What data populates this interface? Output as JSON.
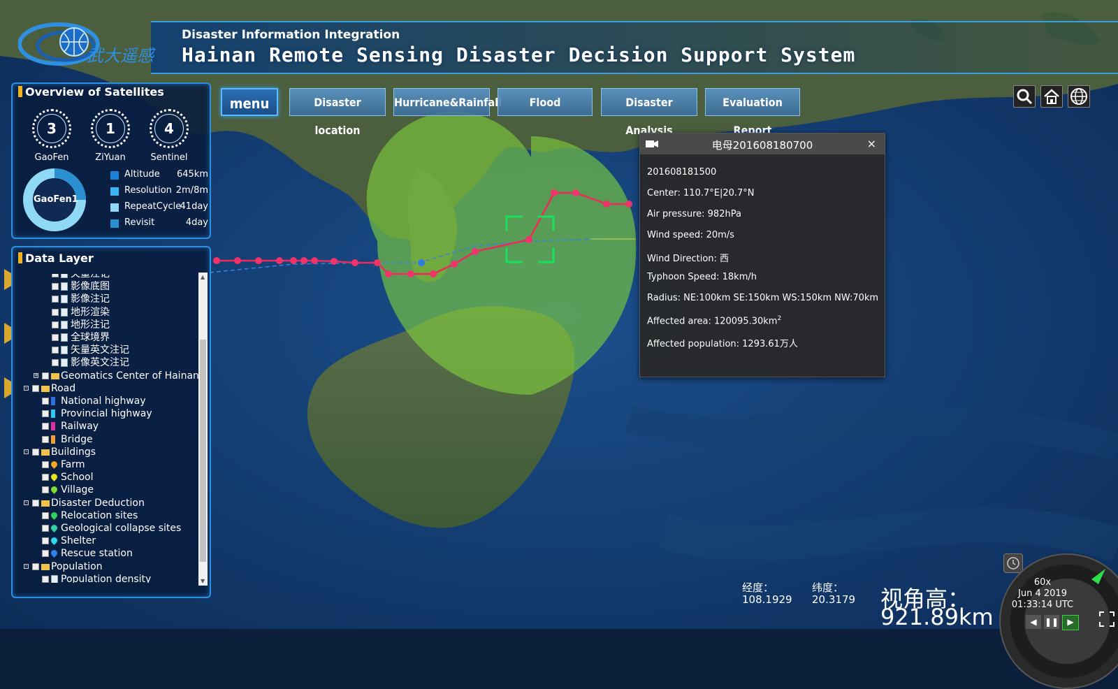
{
  "header": {
    "subtitle": "Disaster Information Integration",
    "title": "Hainan Remote Sensing Disaster Decision Support System",
    "logo_text": "武大遥感"
  },
  "nav": {
    "menu": "menu",
    "items": [
      "Disaster location",
      "Hurricane&Rainfall",
      "Flood",
      "Disaster Analysis",
      "Evaluation Report"
    ]
  },
  "toolbar_icons": [
    "search-icon",
    "home-icon",
    "globe-icon"
  ],
  "satellites": {
    "title": "Overview of Satellites",
    "counts": [
      {
        "value": "3",
        "name": "GaoFen"
      },
      {
        "value": "1",
        "name": "ZiYuan"
      },
      {
        "value": "4",
        "name": "Sentinel"
      }
    ],
    "donut_label": "GaoFen1",
    "info": [
      {
        "key": "Altitude",
        "value": "645km",
        "color": "#1e7fd8"
      },
      {
        "key": "Resolution",
        "value": "2m/8m",
        "color": "#3bb4f2"
      },
      {
        "key": "RepeatCycle",
        "value": "41day",
        "color": "#8fd8f6"
      },
      {
        "key": "Revisit",
        "value": "4day",
        "color": "#2a8fd0"
      }
    ]
  },
  "data_layer": {
    "title": "Data Layer",
    "items": [
      {
        "label": "矢量注记",
        "level": 2,
        "icon": "page"
      },
      {
        "label": "影像底图",
        "level": 2,
        "icon": "page"
      },
      {
        "label": "影像注记",
        "level": 2,
        "icon": "page"
      },
      {
        "label": "地形渲染",
        "level": 2,
        "icon": "page"
      },
      {
        "label": "地形注记",
        "level": 2,
        "icon": "page"
      },
      {
        "label": "全球境界",
        "level": 2,
        "icon": "page"
      },
      {
        "label": "矢量英文注记",
        "level": 2,
        "icon": "page"
      },
      {
        "label": "影像英文注记",
        "level": 2,
        "icon": "page"
      },
      {
        "label": "Geomatics Center of Hainan",
        "level": 1,
        "icon": "folder",
        "expand": "+"
      },
      {
        "label": "Road",
        "level": 0,
        "icon": "folder",
        "expand": "-"
      },
      {
        "label": "National highway",
        "level": 1,
        "icon": "blue"
      },
      {
        "label": "Provincial highway",
        "level": 1,
        "icon": "cyan"
      },
      {
        "label": "Railway",
        "level": 1,
        "icon": "magenta"
      },
      {
        "label": "Bridge",
        "level": 1,
        "icon": "orange"
      },
      {
        "label": "Buildings",
        "level": 0,
        "icon": "folder",
        "expand": "-"
      },
      {
        "label": "Farm",
        "level": 1,
        "icon": "pin-orange"
      },
      {
        "label": "School",
        "level": 1,
        "icon": "pin-yellow"
      },
      {
        "label": "Village",
        "level": 1,
        "icon": "pin-lime"
      },
      {
        "label": "Disaster Deduction",
        "level": 0,
        "icon": "folder",
        "expand": "-"
      },
      {
        "label": "Relocation sites",
        "level": 1,
        "icon": "pin-green"
      },
      {
        "label": "Geological collapse sites",
        "level": 1,
        "icon": "pin-teal"
      },
      {
        "label": "Shelter",
        "level": 1,
        "icon": "pin-cyan"
      },
      {
        "label": "Rescue station",
        "level": 1,
        "icon": "pin-blue"
      },
      {
        "label": "Population",
        "level": 0,
        "icon": "folder",
        "expand": "-"
      },
      {
        "label": "Population density",
        "level": 1,
        "icon": "page"
      }
    ]
  },
  "popup": {
    "title": "电母201608180700",
    "time": "201608181500",
    "center": "Center: 110.7°E|20.7°N",
    "pressure": "Air pressure: 982hPa",
    "wind_speed": "Wind speed: 20m/s",
    "wind_direction": "Wind Direction: 西",
    "typhoon_speed": "Typhoon Speed: 18km/h",
    "radius": "Radius: NE:100km  SE:150km  WS:150km  NW:70km",
    "affected_area": "Affected area: 120095.30km",
    "affected_area_sup": "2",
    "affected_population": "Affected population: 1293.61万人",
    "close": "×"
  },
  "coords": {
    "lon_label": "经度：",
    "lon_value": "108.1929",
    "lat_label": "纬度：",
    "lat_value": "20.3179",
    "alt_label": "视角高：",
    "alt_value": "921.89km"
  },
  "clock": {
    "speed": "60x",
    "date": "Jun 4 2019",
    "time": "01:33:14 UTC"
  }
}
